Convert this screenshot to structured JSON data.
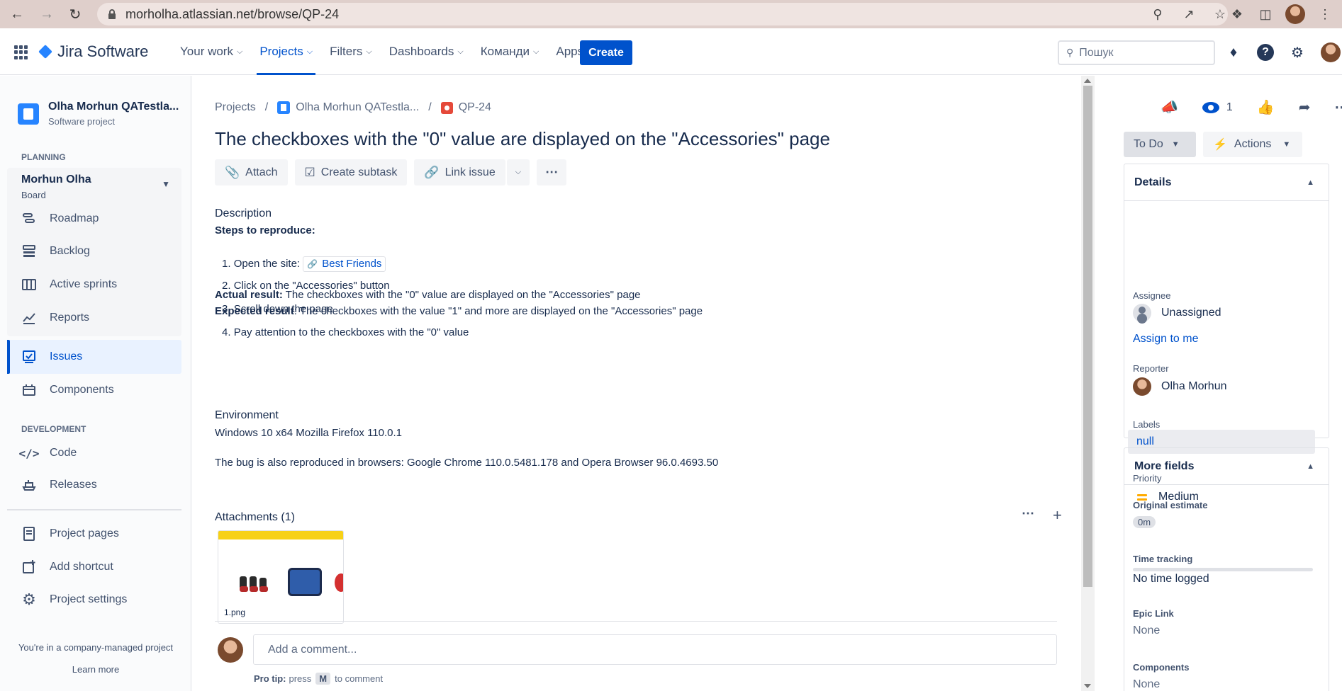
{
  "browser": {
    "url": "morholha.atlassian.net/browse/QP-24"
  },
  "topbar": {
    "product": "Jira Software",
    "menu": [
      {
        "label": "Your work",
        "active": false
      },
      {
        "label": "Projects",
        "active": true
      },
      {
        "label": "Filters",
        "active": false
      },
      {
        "label": "Dashboards",
        "active": false
      },
      {
        "label": "Команди",
        "active": false
      },
      {
        "label": "Apps",
        "active": false
      }
    ],
    "create_label": "Create",
    "search_placeholder": "Пошук"
  },
  "sidebar": {
    "project_name": "Olha Morhun QATestla...",
    "project_type": "Software project",
    "planning_title": "PLANNING",
    "board_name": "Morhun Olha",
    "board_sub": "Board",
    "planning_items": [
      {
        "label": "Roadmap",
        "icon": "roadmap-icon"
      },
      {
        "label": "Backlog",
        "icon": "backlog-icon"
      },
      {
        "label": "Active sprints",
        "icon": "active-sprints-icon"
      },
      {
        "label": "Reports",
        "icon": "reports-icon"
      }
    ],
    "issues_label": "Issues",
    "components_label": "Components",
    "development_title": "DEVELOPMENT",
    "code_label": "Code",
    "releases_label": "Releases",
    "project_pages_label": "Project pages",
    "add_shortcut_label": "Add shortcut",
    "project_settings_label": "Project settings",
    "footer_text": "You're in a company-managed project",
    "learn_more": "Learn more"
  },
  "issue": {
    "breadcrumb": {
      "projects": "Projects",
      "project": "Olha Morhun QATestla...",
      "key": "QP-24"
    },
    "title": "The checkboxes with the \"0\" value are displayed on the \"Accessories\" page",
    "toolbar": {
      "attach": "Attach",
      "create_subtask": "Create subtask",
      "link_issue": "Link issue"
    },
    "description_label": "Description",
    "steps_heading": "Steps to reproduce:",
    "steps": [
      {
        "num": "1.",
        "text": "Open the site:",
        "link": "Best Friends"
      },
      {
        "num": "2.",
        "text": "Click on the \"Accessories\" button"
      },
      {
        "num": "3.",
        "text": "Scroll down the page"
      },
      {
        "num": "4.",
        "text": "Pay attention to the checkboxes with the \"0\" value"
      }
    ],
    "actual_label": "Actual result:",
    "actual_text": " The checkboxes with the \"0\" value are displayed on the \"Accessories\" page",
    "expected_label": "Expected result",
    "expected_text": ": The checkboxes with the value \"1\" and more are displayed on the \"Accessories\" page",
    "environment_label": "Environment",
    "environment_value": "Windows 10 x64 Mozilla Firefox 110.0.1",
    "also_reproduced": "The bug is also reproduced in browsers: Google Chrome 110.0.5481.178 and Opera Browser 96.0.4693.50",
    "attachments_label": "Attachments (1)",
    "attachment_filename": "1.png",
    "comment_placeholder": "Add a comment...",
    "protip_label": "Pro tip:",
    "protip_press": "press",
    "protip_key": "M",
    "protip_suffix": "to comment"
  },
  "panel": {
    "watch_count": "1",
    "status": "To Do",
    "actions": "Actions",
    "details_title": "Details",
    "assignee_label": "Assignee",
    "assignee_value": "Unassigned",
    "assign_to_me": "Assign to me",
    "reporter_label": "Reporter",
    "reporter_value": "Olha Morhun",
    "labels_label": "Labels",
    "labels_value": "null",
    "priority_label": "Priority",
    "priority_value": "Medium",
    "more_fields_title": "More fields",
    "original_estimate_label": "Original estimate",
    "original_estimate_value": "0m",
    "time_tracking_label": "Time tracking",
    "time_tracking_value": "No time logged",
    "epic_link_label": "Epic Link",
    "epic_link_value": "None",
    "components_label": "Components",
    "components_value": "None"
  },
  "colors": {
    "brand": "#0052CC",
    "browser_bar": "#DFCFCB",
    "priority_medium": "#FFAB00",
    "bug": "#E5493A"
  }
}
